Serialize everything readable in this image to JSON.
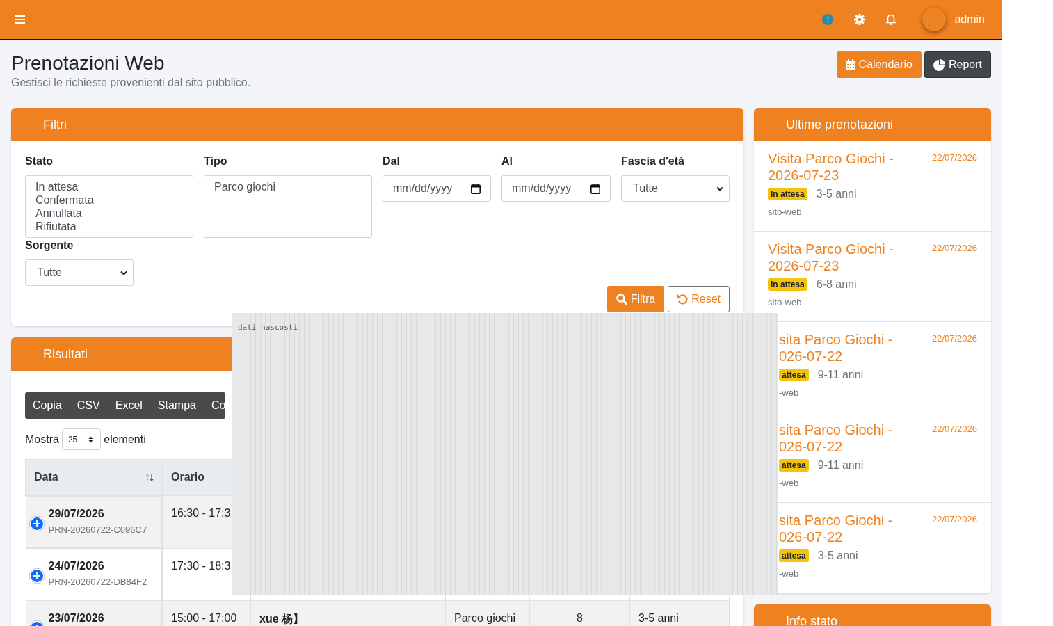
{
  "topbar": {
    "user": "admin"
  },
  "page": {
    "title": "Prenotazioni Web",
    "subtitle": "Gestisci le richieste provenienti dal sito pubblico.",
    "actions": [
      {
        "label": "Calendario",
        "kind": "primary"
      },
      {
        "label": "Report",
        "kind": "dark"
      }
    ]
  },
  "filters": {
    "title": "Filtri",
    "fields": [
      {
        "label": "Stato",
        "kind": "multiselect",
        "options": [
          "In attesa",
          "Confermata",
          "Annullata",
          "Rifiutata"
        ]
      },
      {
        "label": "Tipo",
        "kind": "multiselect",
        "options": [
          "Parco giochi"
        ]
      },
      {
        "label": "Dal",
        "kind": "date",
        "placeholder": "mm/dd/yyyy"
      },
      {
        "label": "Al",
        "kind": "date",
        "placeholder": "mm/dd/yyyy"
      },
      {
        "label": "Fascia d'età",
        "kind": "select",
        "value": "Tutte"
      },
      {
        "label": "Sorgente",
        "kind": "select",
        "value": "Tutte"
      }
    ],
    "buttons": [
      {
        "label": "Filtra",
        "kind": "primary"
      },
      {
        "label": "Reset",
        "kind": "outline"
      }
    ]
  },
  "results": {
    "title": "Risultati",
    "export_buttons": [
      "Copia",
      "CSV",
      "Excel",
      "Stampa",
      "Co"
    ],
    "length": {
      "before": "Mostra",
      "value": "25",
      "after": "elementi"
    },
    "table": {
      "columns": [
        "Data",
        "Orario"
      ],
      "rows": [
        {
          "date": "29/07/2026",
          "code": "PRN-20260722-C096C7",
          "time": "16:30 - 17:3",
          "cells": []
        },
        {
          "date": "24/07/2026",
          "code": "PRN-20260722-DB84F2",
          "time": "17:30 - 18:3",
          "cells": []
        },
        {
          "date": "23/07/2026",
          "time": "15:00 - 17:00",
          "cells": [
            "xue 杨】",
            "Parco giochi",
            "8",
            "3-5 anni"
          ]
        }
      ]
    }
  },
  "latest": {
    "title": "Ultime prenotazioni",
    "items": [
      {
        "title": "Visita Parco Giochi - 2026-07-23",
        "date": "22/07/2026",
        "status": "In attesa",
        "age": "3-5 anni",
        "source": "sito-web",
        "covered": false
      },
      {
        "title": "Visita Parco Giochi - 2026-07-23",
        "date": "22/07/2026",
        "status": "In attesa",
        "age": "6-8 anni",
        "source": "sito-web",
        "covered": false
      },
      {
        "title": "sita Parco Giochi - 026-07-22",
        "date": "22/07/2026",
        "status": "attesa",
        "age": "9-11 anni",
        "source": "-web",
        "covered": true
      },
      {
        "title": "sita Parco Giochi - 026-07-22",
        "date": "22/07/2026",
        "status": "attesa",
        "age": "9-11 anni",
        "source": "-web",
        "covered": true
      },
      {
        "title": "sita Parco Giochi - 026-07-22",
        "date": "22/07/2026",
        "status": "attesa",
        "age": "3-5 anni",
        "source": "-web",
        "covered": true
      }
    ]
  },
  "info": {
    "title": "Info stato"
  },
  "overlay": {
    "label": "dati nascosti"
  }
}
